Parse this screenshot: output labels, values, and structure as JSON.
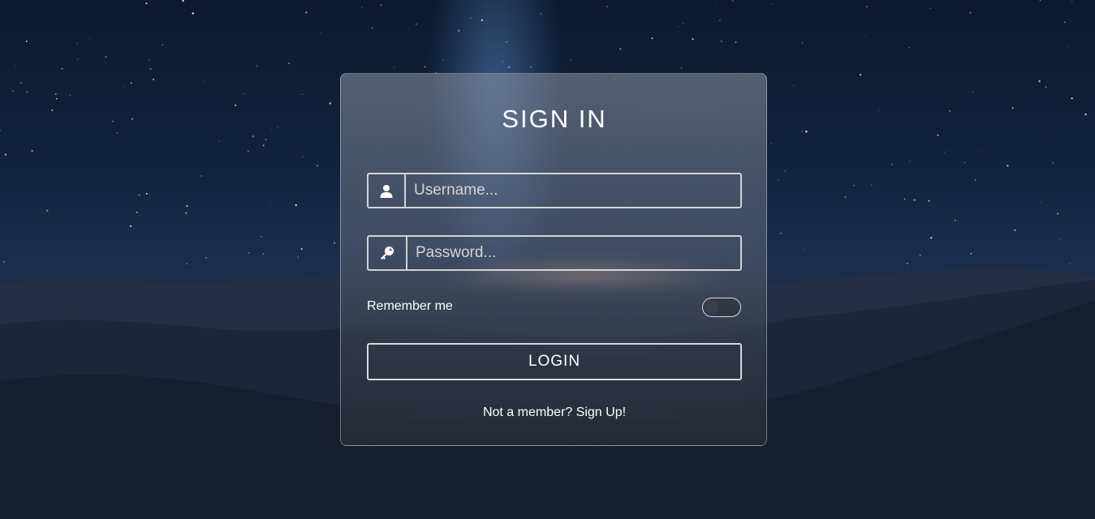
{
  "background": {
    "scene": "night-desert-milky-way",
    "colors": {
      "sky_top": "#0b1a2f",
      "dunes": "#141c2c",
      "horizon_glow": "#ffbe96"
    }
  },
  "login_card": {
    "title": "SIGN IN",
    "username": {
      "placeholder": "Username...",
      "value": "",
      "icon": "user-icon"
    },
    "password": {
      "placeholder": "Password...",
      "value": "",
      "icon": "key-icon"
    },
    "remember_me": {
      "label": "Remember me",
      "checked": false
    },
    "login_button": "LOGIN",
    "signup_link": "Not a member? Sign Up!"
  }
}
